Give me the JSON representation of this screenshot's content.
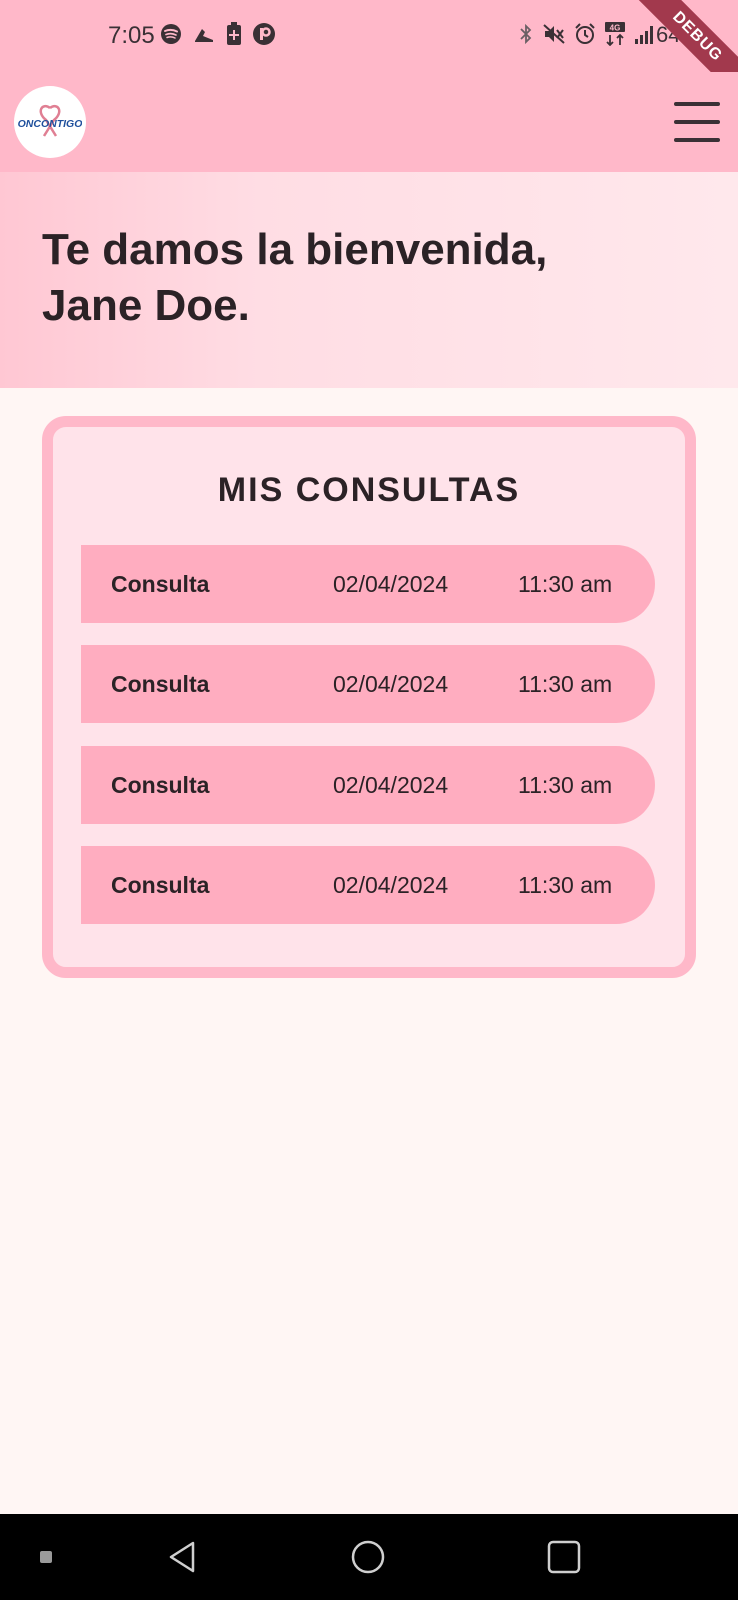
{
  "status_bar": {
    "time": "7:05",
    "battery": "64%",
    "left_icons": [
      "spotify-icon",
      "shoe-icon",
      "battery-saver-icon",
      "app-icon"
    ],
    "right_icons": [
      "bluetooth-icon",
      "mute-icon",
      "alarm-icon",
      "data-4g-icon",
      "signal-icon"
    ],
    "debug_label": "DEBUG"
  },
  "app_bar": {
    "logo_text": "ONCONTIGO",
    "menu_icon": "hamburger-menu-icon"
  },
  "welcome": {
    "line1": "Te damos la bienvenida,",
    "line2": "Jane Doe."
  },
  "consultas": {
    "title": "MIS CONSULTAS",
    "rows": [
      {
        "label": "Consulta",
        "date": "02/04/2024",
        "time": "11:30 am"
      },
      {
        "label": "Consulta",
        "date": "02/04/2024",
        "time": "11:30 am"
      },
      {
        "label": "Consulta",
        "date": "02/04/2024",
        "time": "11:30 am"
      },
      {
        "label": "Consulta",
        "date": "02/04/2024",
        "time": "11:30 am"
      }
    ]
  },
  "nav_bar": {
    "items": [
      "recents-dot-icon",
      "back-icon",
      "home-icon",
      "overview-icon"
    ]
  },
  "colors": {
    "app_bar": "#ffb8c9",
    "card_border": "#ffb8c9",
    "card_bg": "#ffe3ea",
    "row_bg": "#ffadc0",
    "page_bg": "#fff6f4",
    "ribbon": "#a2394d"
  }
}
